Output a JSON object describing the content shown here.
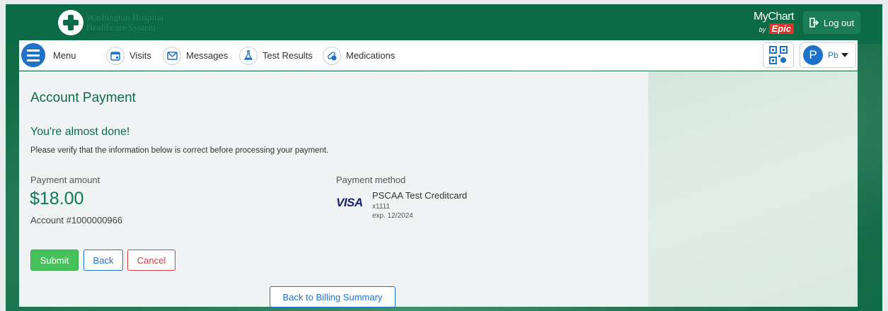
{
  "header": {
    "org_name_line1": "Washington Hospital",
    "org_name_line2": "Healthcare System",
    "mychart_label": "MyChart",
    "by_label": "by",
    "epic_label": "Epic",
    "logout_label": "Log out"
  },
  "nav": {
    "menu_label": "Menu",
    "items": [
      {
        "label": "Visits",
        "icon": "calendar-icon"
      },
      {
        "label": "Messages",
        "icon": "envelope-icon"
      },
      {
        "label": "Test Results",
        "icon": "flask-icon"
      },
      {
        "label": "Medications",
        "icon": "pills-icon"
      }
    ],
    "user_avatar_letter": "P",
    "user_initials": "Pb"
  },
  "page": {
    "title": "Account Payment",
    "almost_done": "You're almost done!",
    "verify_text": "Please verify that the information below is correct before processing your payment.",
    "payment_amount_label": "Payment amount",
    "payment_amount": "$18.00",
    "account_number": "Account #1000000966",
    "payment_method_label": "Payment method",
    "card_brand": "VISA",
    "card_name": "PSCAA Test Creditcard",
    "card_last4": "x1111",
    "card_expiry": "exp. 12/2024"
  },
  "buttons": {
    "submit": "Submit",
    "back": "Back",
    "cancel": "Cancel",
    "back_to_billing": "Back to Billing Summary"
  },
  "colors": {
    "brand_green": "#0b6b47",
    "primary_blue": "#1f72c7",
    "submit_green": "#46c25a",
    "cancel_red": "#d0404a"
  }
}
